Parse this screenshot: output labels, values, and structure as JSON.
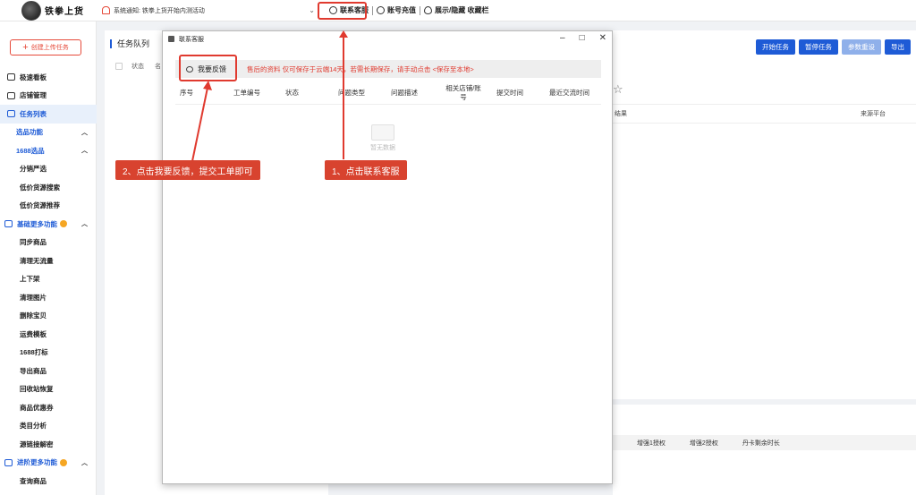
{
  "app": {
    "name": "铁拳上货"
  },
  "topbar": {
    "notice": "系统通知: 铁拳上货开始内测活动",
    "contact_service": "联系客服",
    "account_recharge": "账号充值",
    "toggle_label": "展示/隐藏 收藏栏"
  },
  "sidebar": {
    "create_btn": "创建上传任务",
    "items": [
      {
        "label": "极速看板"
      },
      {
        "label": "店铺管理"
      },
      {
        "label": "任务列表"
      }
    ],
    "group1": "选品功能",
    "group1_items": [
      "1688选品",
      "分销严选",
      "低价货源搜索",
      "低价货源推荐"
    ],
    "group2": "基础更多功能",
    "group2_items": [
      "同步商品",
      "清理无流量",
      "上下架",
      "清理图片",
      "删除宝贝",
      "运费模板",
      "1688打标",
      "导出商品",
      "回收站恢复",
      "商品优惠券",
      "类目分析",
      "源链接解密"
    ],
    "group3": "进阶更多功能",
    "group3_items": [
      "查询商品"
    ]
  },
  "main": {
    "title": "任务队列",
    "col_status": "状态",
    "col_partial": "名"
  },
  "right": {
    "buttons": [
      "开始任务",
      "暂停任务",
      "参数重设",
      "导出"
    ],
    "col_result": "结果",
    "col_source": "来源平台",
    "lower_cols": [
      "增强1授权",
      "增强2授权",
      "丹卡剩余时长"
    ]
  },
  "dialog": {
    "title": "联系客服",
    "feedback_btn": "我要反馈",
    "notice": "售后的资料 仅可保存于云端14天，若需长期保存，请手动点击 <保存至本地>",
    "columns": [
      "序号",
      "工单编号",
      "状态",
      "问题类型",
      "问题描述",
      "相关店铺/账号",
      "提交时间",
      "最近交流时间"
    ],
    "empty_text": "暂无数据"
  },
  "callouts": {
    "step1": "1、点击联系客服",
    "step2": "2、点击我要反馈，提交工单即可"
  },
  "colors": {
    "accent": "#1e5bd6",
    "alert": "#e03a2f"
  }
}
